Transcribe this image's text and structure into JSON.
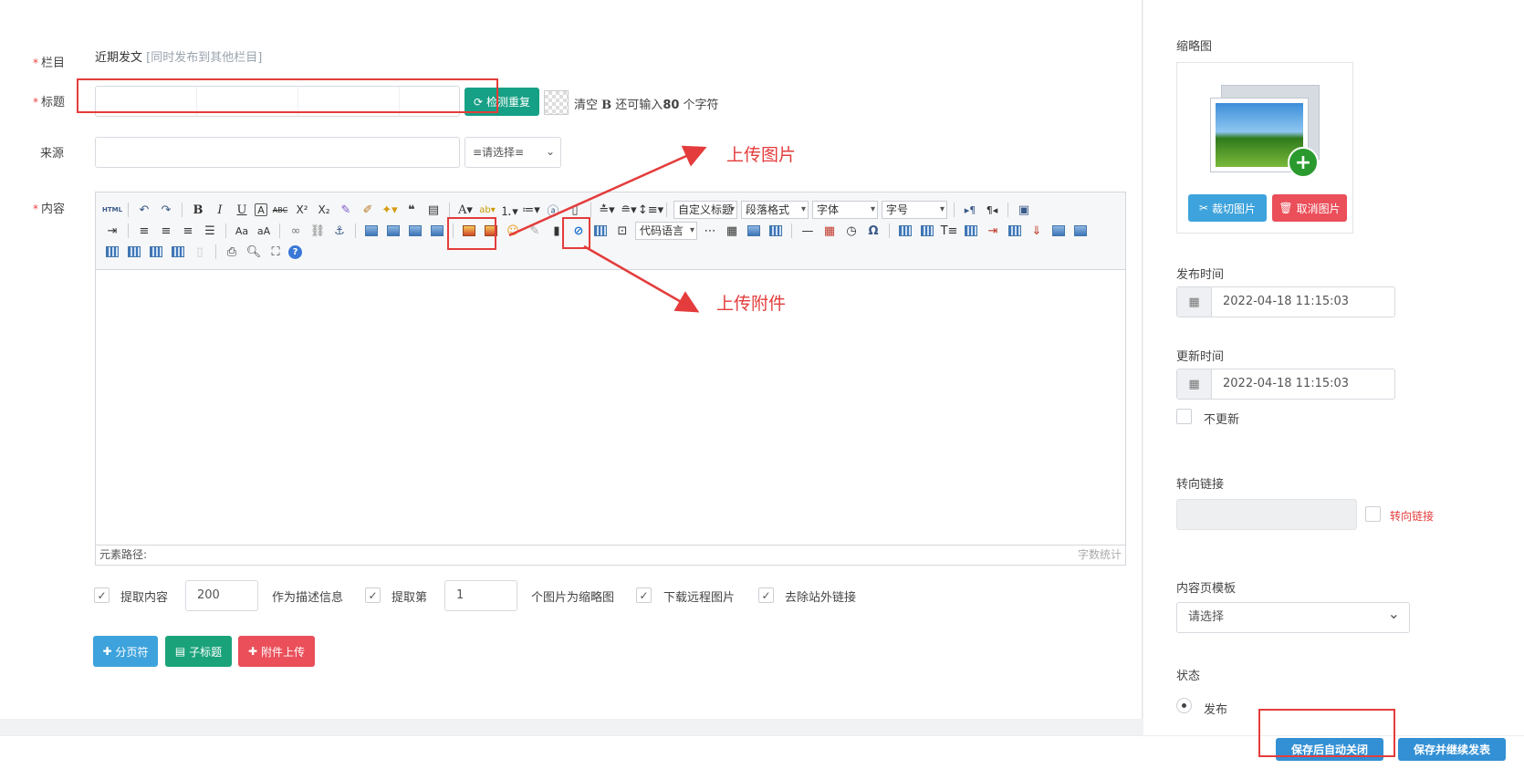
{
  "form": {
    "column_label": "栏目",
    "column_value": "近期发文",
    "column_extra": "[同时发布到其他栏目]",
    "title_label": "标题",
    "title_value": "",
    "check_dup_label": "检测重复",
    "clear_label": "清空",
    "bold_label": "B",
    "remain_prefix": "还可输入",
    "remain_count": "80",
    "remain_suffix": "个字符",
    "source_label": "来源",
    "source_value": "",
    "source_select": "≡请选择≡",
    "content_label": "内容"
  },
  "editor": {
    "toolbar_selects": {
      "custom_title": "自定义标题",
      "paragraph": "段落格式",
      "font": "字体",
      "font_size": "字号",
      "code_lang": "代码语言"
    },
    "element_path": "元素路径:",
    "word_count": "字数统计"
  },
  "options": {
    "extract_content": "提取内容",
    "extract_length": "200",
    "as_description": "作为描述信息",
    "extract_nth": "提取第",
    "nth_value": "1",
    "as_thumb": "个图片为缩略图",
    "download_remote": "下载远程图片",
    "remove_links": "去除站外链接"
  },
  "actions": {
    "pagebreak": "分页符",
    "subtitle": "子标题",
    "attach_upload": "附件上传"
  },
  "annotations": {
    "upload_image": "上传图片",
    "upload_attachment": "上传附件"
  },
  "sidebar": {
    "thumb_label": "缩略图",
    "crop_image": "裁切图片",
    "cancel_image": "取消图片",
    "publish_time_label": "发布时间",
    "publish_time": "2022-04-18 11:15:03",
    "update_time_label": "更新时间",
    "update_time": "2022-04-18 11:15:03",
    "no_update": "不更新",
    "redirect_label": "转向链接",
    "redirect_check": "转向链接",
    "template_label": "内容页模板",
    "template_value": "请选择",
    "status_label": "状态",
    "status_publish": "发布"
  },
  "footer": {
    "save_close": "保存后自动关闭",
    "save_continue": "保存并继续发表"
  },
  "colors": {
    "accent_red": "#e43c3c",
    "teal": "#16a085",
    "blue": "#3ea3dc",
    "danger": "#ea4f5a",
    "save_blue": "#3390d4"
  }
}
